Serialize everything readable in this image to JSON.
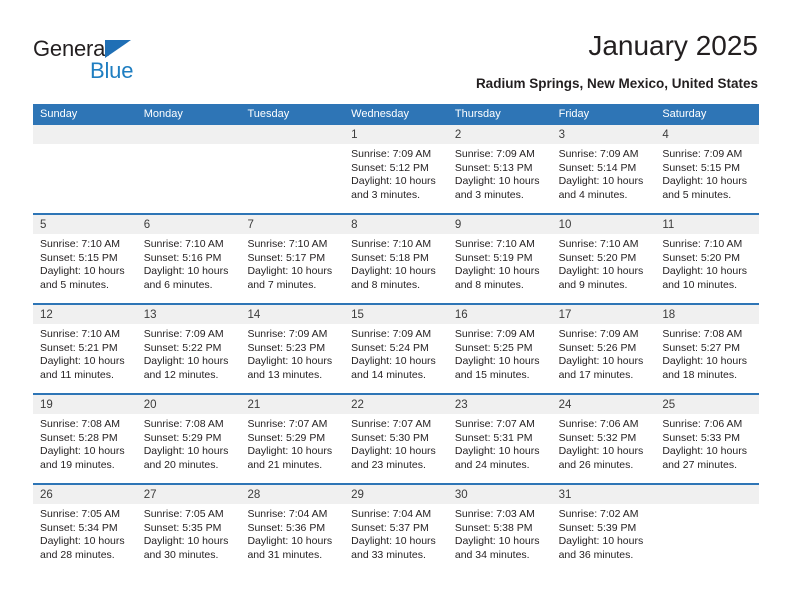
{
  "brand": {
    "name_top": "General",
    "name_bottom": "Blue",
    "triangle_color": "#1f6fb5",
    "blue_color": "#1f7ec1"
  },
  "header": {
    "title": "January 2025",
    "subtitle": "Radium Springs, New Mexico, United States"
  },
  "theme": {
    "header_blue": "#2e75b6",
    "band_gray": "#f0f0f0",
    "text": "#231f20"
  },
  "weekdays": [
    "Sunday",
    "Monday",
    "Tuesday",
    "Wednesday",
    "Thursday",
    "Friday",
    "Saturday"
  ],
  "weeks": [
    [
      {
        "day": "",
        "lines": ""
      },
      {
        "day": "",
        "lines": ""
      },
      {
        "day": "",
        "lines": ""
      },
      {
        "day": "1",
        "lines": "Sunrise: 7:09 AM\nSunset: 5:12 PM\nDaylight: 10 hours and 3 minutes."
      },
      {
        "day": "2",
        "lines": "Sunrise: 7:09 AM\nSunset: 5:13 PM\nDaylight: 10 hours and 3 minutes."
      },
      {
        "day": "3",
        "lines": "Sunrise: 7:09 AM\nSunset: 5:14 PM\nDaylight: 10 hours and 4 minutes."
      },
      {
        "day": "4",
        "lines": "Sunrise: 7:09 AM\nSunset: 5:15 PM\nDaylight: 10 hours and 5 minutes."
      }
    ],
    [
      {
        "day": "5",
        "lines": "Sunrise: 7:10 AM\nSunset: 5:15 PM\nDaylight: 10 hours and 5 minutes."
      },
      {
        "day": "6",
        "lines": "Sunrise: 7:10 AM\nSunset: 5:16 PM\nDaylight: 10 hours and 6 minutes."
      },
      {
        "day": "7",
        "lines": "Sunrise: 7:10 AM\nSunset: 5:17 PM\nDaylight: 10 hours and 7 minutes."
      },
      {
        "day": "8",
        "lines": "Sunrise: 7:10 AM\nSunset: 5:18 PM\nDaylight: 10 hours and 8 minutes."
      },
      {
        "day": "9",
        "lines": "Sunrise: 7:10 AM\nSunset: 5:19 PM\nDaylight: 10 hours and 8 minutes."
      },
      {
        "day": "10",
        "lines": "Sunrise: 7:10 AM\nSunset: 5:20 PM\nDaylight: 10 hours and 9 minutes."
      },
      {
        "day": "11",
        "lines": "Sunrise: 7:10 AM\nSunset: 5:20 PM\nDaylight: 10 hours and 10 minutes."
      }
    ],
    [
      {
        "day": "12",
        "lines": "Sunrise: 7:10 AM\nSunset: 5:21 PM\nDaylight: 10 hours and 11 minutes."
      },
      {
        "day": "13",
        "lines": "Sunrise: 7:09 AM\nSunset: 5:22 PM\nDaylight: 10 hours and 12 minutes."
      },
      {
        "day": "14",
        "lines": "Sunrise: 7:09 AM\nSunset: 5:23 PM\nDaylight: 10 hours and 13 minutes."
      },
      {
        "day": "15",
        "lines": "Sunrise: 7:09 AM\nSunset: 5:24 PM\nDaylight: 10 hours and 14 minutes."
      },
      {
        "day": "16",
        "lines": "Sunrise: 7:09 AM\nSunset: 5:25 PM\nDaylight: 10 hours and 15 minutes."
      },
      {
        "day": "17",
        "lines": "Sunrise: 7:09 AM\nSunset: 5:26 PM\nDaylight: 10 hours and 17 minutes."
      },
      {
        "day": "18",
        "lines": "Sunrise: 7:08 AM\nSunset: 5:27 PM\nDaylight: 10 hours and 18 minutes."
      }
    ],
    [
      {
        "day": "19",
        "lines": "Sunrise: 7:08 AM\nSunset: 5:28 PM\nDaylight: 10 hours and 19 minutes."
      },
      {
        "day": "20",
        "lines": "Sunrise: 7:08 AM\nSunset: 5:29 PM\nDaylight: 10 hours and 20 minutes."
      },
      {
        "day": "21",
        "lines": "Sunrise: 7:07 AM\nSunset: 5:29 PM\nDaylight: 10 hours and 21 minutes."
      },
      {
        "day": "22",
        "lines": "Sunrise: 7:07 AM\nSunset: 5:30 PM\nDaylight: 10 hours and 23 minutes."
      },
      {
        "day": "23",
        "lines": "Sunrise: 7:07 AM\nSunset: 5:31 PM\nDaylight: 10 hours and 24 minutes."
      },
      {
        "day": "24",
        "lines": "Sunrise: 7:06 AM\nSunset: 5:32 PM\nDaylight: 10 hours and 26 minutes."
      },
      {
        "day": "25",
        "lines": "Sunrise: 7:06 AM\nSunset: 5:33 PM\nDaylight: 10 hours and 27 minutes."
      }
    ],
    [
      {
        "day": "26",
        "lines": "Sunrise: 7:05 AM\nSunset: 5:34 PM\nDaylight: 10 hours and 28 minutes."
      },
      {
        "day": "27",
        "lines": "Sunrise: 7:05 AM\nSunset: 5:35 PM\nDaylight: 10 hours and 30 minutes."
      },
      {
        "day": "28",
        "lines": "Sunrise: 7:04 AM\nSunset: 5:36 PM\nDaylight: 10 hours and 31 minutes."
      },
      {
        "day": "29",
        "lines": "Sunrise: 7:04 AM\nSunset: 5:37 PM\nDaylight: 10 hours and 33 minutes."
      },
      {
        "day": "30",
        "lines": "Sunrise: 7:03 AM\nSunset: 5:38 PM\nDaylight: 10 hours and 34 minutes."
      },
      {
        "day": "31",
        "lines": "Sunrise: 7:02 AM\nSunset: 5:39 PM\nDaylight: 10 hours and 36 minutes."
      },
      {
        "day": "",
        "lines": ""
      }
    ]
  ]
}
